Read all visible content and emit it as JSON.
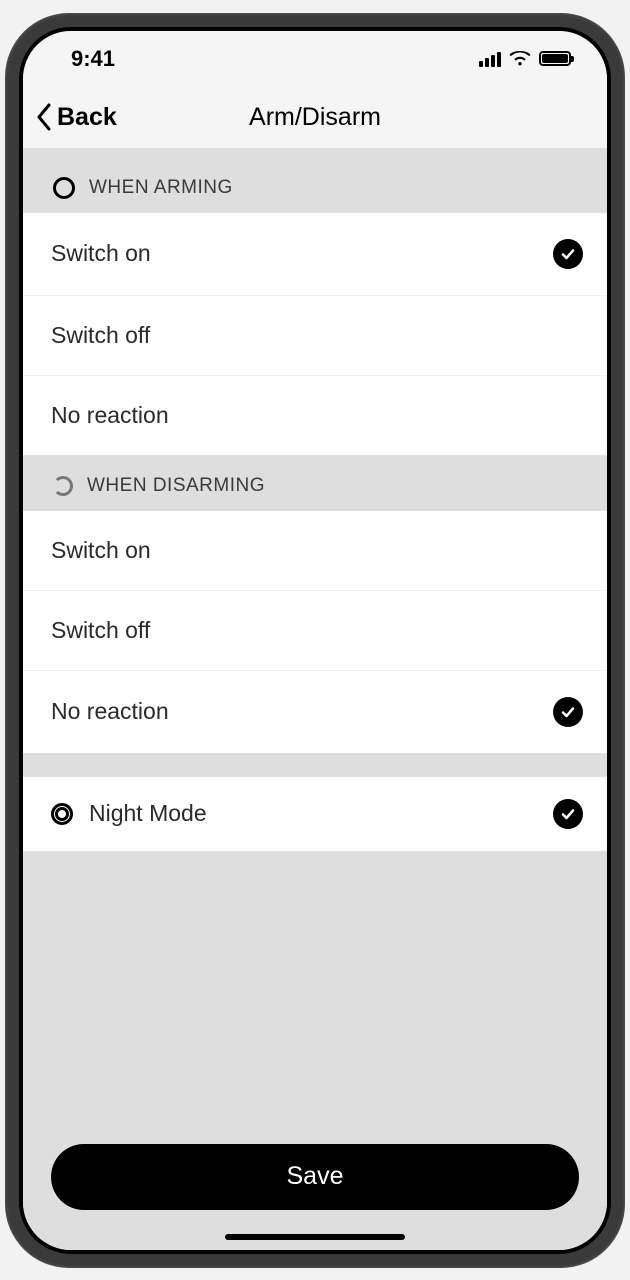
{
  "status": {
    "time": "9:41"
  },
  "nav": {
    "back": "Back",
    "title": "Arm/Disarm"
  },
  "sections": {
    "arming": {
      "header": "WHEN ARMING",
      "options": {
        "switch_on": "Switch on",
        "switch_off": "Switch off",
        "no_reaction": "No reaction"
      },
      "selected": "switch_on"
    },
    "disarming": {
      "header": "WHEN DISARMING",
      "options": {
        "switch_on": "Switch on",
        "switch_off": "Switch off",
        "no_reaction": "No reaction"
      },
      "selected": "no_reaction"
    },
    "night": {
      "label": "Night Mode",
      "checked": true
    }
  },
  "buttons": {
    "save": "Save"
  }
}
